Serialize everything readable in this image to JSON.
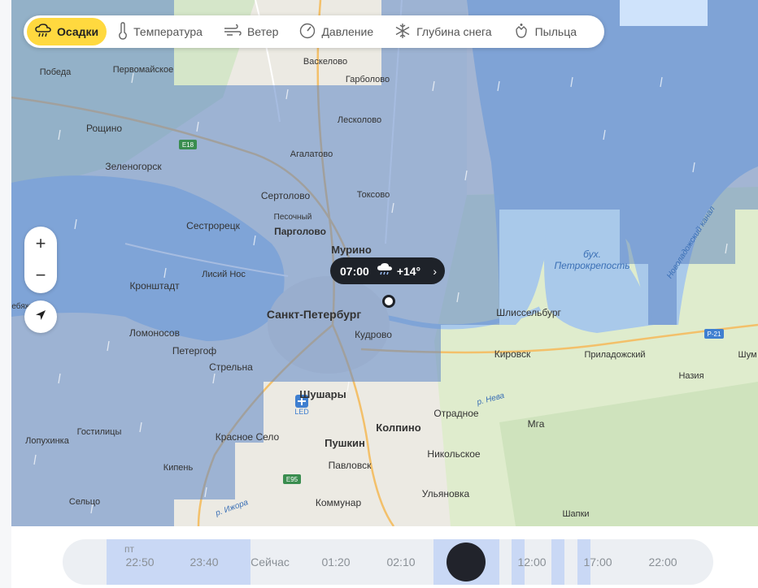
{
  "layers": [
    {
      "label": "Осадки",
      "icon": "precipitation-icon",
      "active": true
    },
    {
      "label": "Температура",
      "icon": "thermometer-icon",
      "active": false
    },
    {
      "label": "Ветер",
      "icon": "wind-icon",
      "active": false
    },
    {
      "label": "Давление",
      "icon": "pressure-gauge-icon",
      "active": false
    },
    {
      "label": "Глубина снега",
      "icon": "snowflake-icon",
      "active": false
    },
    {
      "label": "Пыльца",
      "icon": "pollen-icon",
      "active": false
    }
  ],
  "zoom": {
    "in": "+",
    "out": "−"
  },
  "weather_popup": {
    "time": "07:00",
    "temp": "+14°",
    "icon": "rain-cloud-icon",
    "chevron": "›"
  },
  "places": [
    "Васкелово",
    "Гарболово",
    "Победа",
    "Первомайское",
    "Лесколово",
    "Рощино",
    "Агалатово",
    "Зеленогорск",
    "Токсово",
    "Сертолово",
    "Песочный",
    "Сестрорецк",
    "Парголово",
    "Мурино",
    "Лисий Нос",
    "Кронштадт",
    "Санкт-Петербург",
    "Шлиссельбург",
    "Кудрово",
    "Ломоносов",
    "Петергоф",
    "Кировск",
    "Приладожский",
    "Шум",
    "Стрельна",
    "Назия",
    "Шушары",
    "Отрадное",
    "Колпино",
    "Мга",
    "Гостилицы",
    "Красное Село",
    "Лопухинка",
    "Пушкин",
    "Никольское",
    "Кипень",
    "Павловск",
    "Ульяновка",
    "Сельцо",
    "Коммунар",
    "Шапки",
    "Лебяжье",
    "бух.",
    "Петрокрепость",
    "Новоладожский канал",
    "р. Нева",
    "р. Ижора",
    "LED"
  ],
  "roads": [
    "E18",
    "E95",
    "P-21"
  ],
  "timeline": {
    "day": "пт",
    "slots": [
      "22:50",
      "23:40",
      "Сейчас",
      "01:20",
      "02:10",
      "12:00",
      "17:00",
      "22:00"
    ],
    "colors": {
      "track": "#eceff3",
      "segment": "#c9d8f5",
      "knob": "#21232b"
    }
  },
  "colors": {
    "active_tab": "#ffd93f",
    "rain_overlay": "#5c85c7",
    "land": "#eceae3",
    "water": "#a9c9ea"
  }
}
